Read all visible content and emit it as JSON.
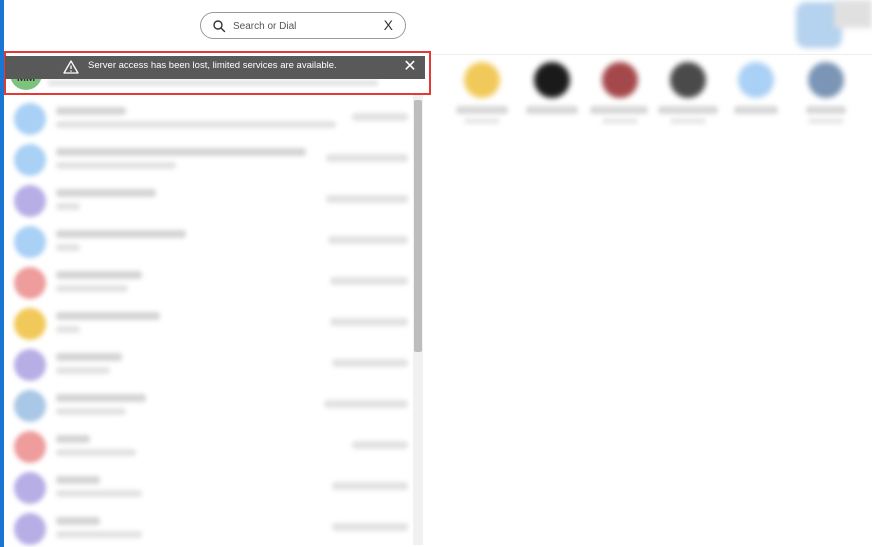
{
  "search": {
    "placeholder": "Search or Dial",
    "clear_label": "X"
  },
  "banner": {
    "message": "Server access has been lost, limited services are available.",
    "close_label": "✕",
    "warning_icon": "warning-icon",
    "avatar_initials": "MM"
  },
  "colors": {
    "accent": "#1976d2",
    "banner_bg": "#595959",
    "highlight_border": "#e53935"
  }
}
